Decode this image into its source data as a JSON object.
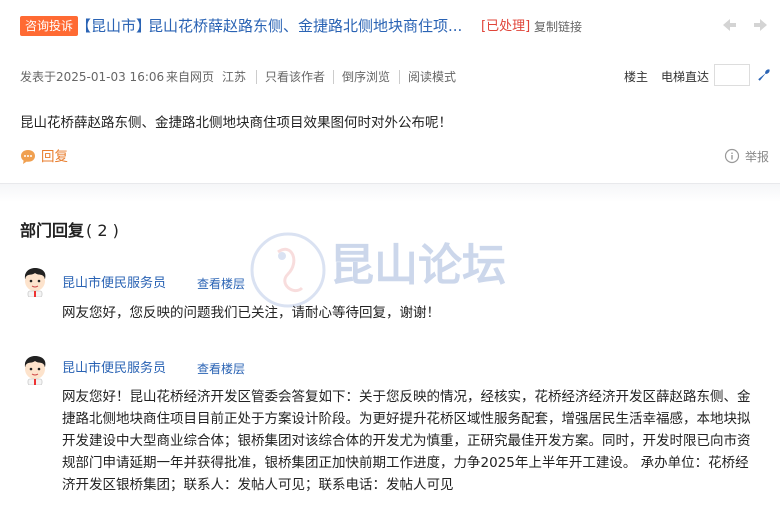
{
  "post": {
    "badge": "咨询投诉",
    "city_tag": "【昆山市】",
    "title": "昆山花桥薛赵路东侧、金捷路北侧地块商住项...",
    "status": "[已处理]",
    "copy_link": "复制链接",
    "meta": {
      "posted": "发表于2025-01-03 16:06",
      "source": "来自网页",
      "region": "江苏",
      "author_only": "只看该作者",
      "reverse": "倒序浏览",
      "read_mode": "阅读模式"
    },
    "floor_label": "楼主",
    "elevator_label": "电梯直达",
    "content": "昆山花桥薛赵路东侧、金捷路北侧地块商住项目效果图何时对外公布呢！",
    "reply_label": "回复",
    "report_label": "举报"
  },
  "replies_section": {
    "title": "部门回复",
    "count": "( 2 )",
    "replies": [
      {
        "author": "昆山市便民服务员",
        "view_floor": "查看楼层",
        "text": "网友您好，您反映的问题我们已关注，请耐心等待回复，谢谢！"
      },
      {
        "author": "昆山市便民服务员",
        "view_floor": "查看楼层",
        "lines": [
          "网友您好！昆山花桥经济开发区管委会答复如下：关于您反映的情况，经核实，花桥经济经济开发区薛赵路东侧、金",
          "捷路北侧地块商住项目目前正处于方案设计阶段。为更好提升花桥区域性服务配套，增强居民生活幸福感，本地块拟",
          "开发建设中大型商业综合体；银桥集团对该综合体的开发尤为慎重，正研究最佳开发方案。同时，开发时限已向市资",
          "规部门申请延期一年并获得批准，银桥集团正加快前期工作进度，力争2025年上半年开工建设。 承办单位：花桥经",
          "济开发区银桥集团；联系人：发帖人可见；联系电话：发帖人可见"
        ]
      }
    ]
  },
  "watermark": "昆山论坛",
  "colors": {
    "accent": "#ff6a33",
    "link": "#2a63b4",
    "status": "#e0453a",
    "reply": "#e87d2d"
  }
}
